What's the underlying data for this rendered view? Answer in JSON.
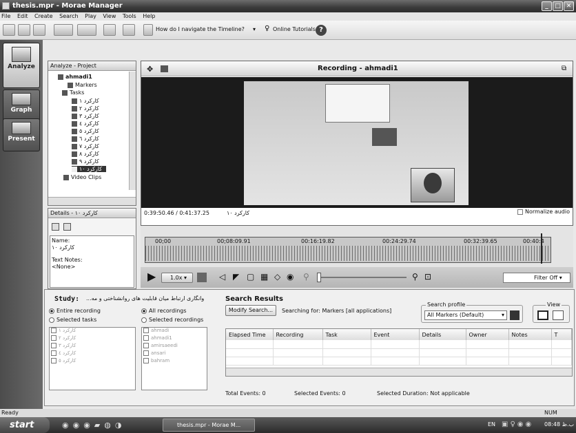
{
  "window": {
    "title": "thesis.mpr - Morae Manager"
  },
  "menu": [
    "File",
    "Edit",
    "Create",
    "Search",
    "Play",
    "View",
    "Tools",
    "Help"
  ],
  "toolbar": {
    "help_question": "How do I navigate the Timeline?",
    "tutorials": "Online Tutorials"
  },
  "nav": [
    {
      "label": "Analyze",
      "icon": "analyze-icon"
    },
    {
      "label": "Graph",
      "icon": "graph-icon"
    },
    {
      "label": "Present",
      "icon": "present-icon"
    }
  ],
  "project": {
    "header": "Analyze - Project",
    "root": "ahmadi1",
    "markers": "Markers",
    "tasks": "Tasks",
    "task_items": [
      "کارکرد ۱",
      "کارکرد ۲",
      "کارکرد ۳",
      "کارکرد ٤",
      "کارکرد ٥",
      "کارکرد ٦",
      "کارکرد ۷",
      "کارکرد ۸",
      "کارکرد ۹",
      "کارکرد ۱۰"
    ],
    "video_clips": "Video Clips"
  },
  "details": {
    "header": "Details - کارکرد ۱۰",
    "name_label": "Name:",
    "name_value": "کارکرد ۱۰",
    "notes_label": "Text Notes:",
    "notes_value": "<None>"
  },
  "recording": {
    "title": "Recording - ahmadi1",
    "time": "0:39:50.46 / 0:41:37.25",
    "task": "کارکرد ۱۰",
    "normalize": "Normalize audio",
    "ticks": [
      "00;00",
      "00;08:09.91",
      "00:16:19.82",
      "00:24:29.74",
      "00:32:39.65",
      "00:40:4"
    ],
    "speed": "1.0x",
    "filter": "Filter Off"
  },
  "study": {
    "label": "Study:",
    "name": "...وانگاری ارتباط میان قابلیت های روانشناختی و مه",
    "entire": "Entire recording",
    "selected_tasks": "Selected tasks",
    "all_recordings": "All recordings",
    "selected_recordings": "Selected recordings",
    "task_list": [
      "کارکرد ۱",
      "کارکرد ۲",
      "کارکرد ۳",
      "کارکرد ٤",
      "کارکرد ٥"
    ],
    "recording_list": [
      "ahmadi",
      "ahmadi1",
      "amirsaeedi",
      "ansari",
      "bahram"
    ]
  },
  "search": {
    "title": "Search Results",
    "modify": "Modify Search...",
    "searching": "Searching for: Markers [all applications]",
    "profile_label": "Search profile",
    "profile_value": "All Markers (Default)",
    "view_label": "View",
    "columns": [
      "Elapsed Time",
      "Recording",
      "Task",
      "Event",
      "Details",
      "Owner",
      "Notes",
      "T"
    ],
    "total_events": "Total Events: 0",
    "selected_events": "Selected Events: 0",
    "selected_duration": "Selected Duration: Not applicable"
  },
  "status": {
    "left": "Ready",
    "right": "NUM"
  },
  "taskbar": {
    "start": "start",
    "task": "thesis.mpr - Morae M...",
    "lang": "EN",
    "clock": "08:48 ب.ظ"
  }
}
